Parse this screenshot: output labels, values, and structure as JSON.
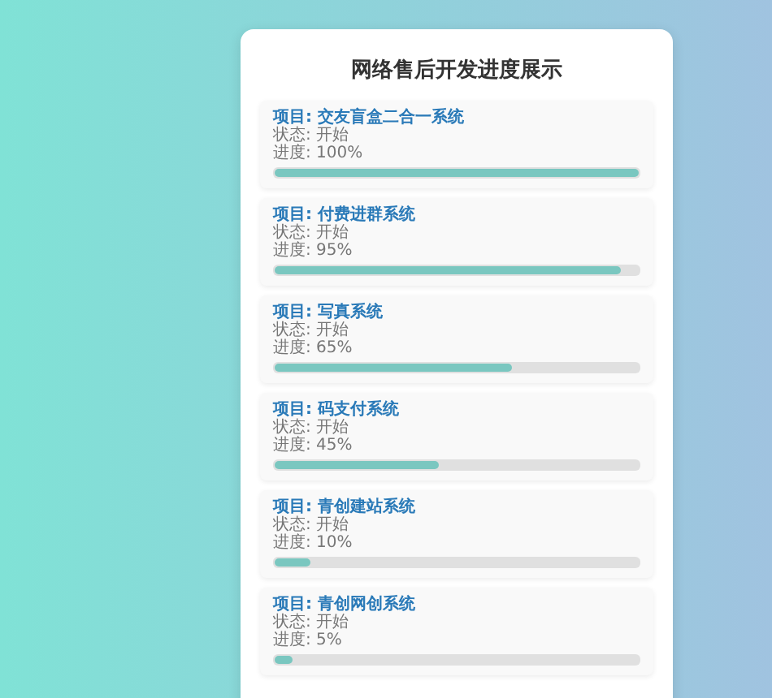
{
  "title": "网络售后开发进度展示",
  "projects": [
    {
      "name": "项目: 交友盲盒二合一系统",
      "status": "状态: 开始",
      "progress": "进度: 100%",
      "level": 1.0
    },
    {
      "name": "项目: 付费进群系统",
      "status": "状态: 开始",
      "progress": "进度: 95%",
      "level": 0.95
    },
    {
      "name": "项目: 写真系统",
      "status": "状态: 开始",
      "progress": "进度: 65%",
      "level": 0.65
    },
    {
      "name": "项目: 码支付系统",
      "status": "状态: 开始",
      "progress": "进度: 45%",
      "level": 0.45
    },
    {
      "name": "项目: 青创建站系统",
      "status": "状态: 开始",
      "progress": "进度: 10%",
      "level": 0.1
    },
    {
      "name": "项目: 青创网创系统",
      "status": "状态: 开始",
      "progress": "进度: 5%",
      "level": 0.05
    }
  ]
}
